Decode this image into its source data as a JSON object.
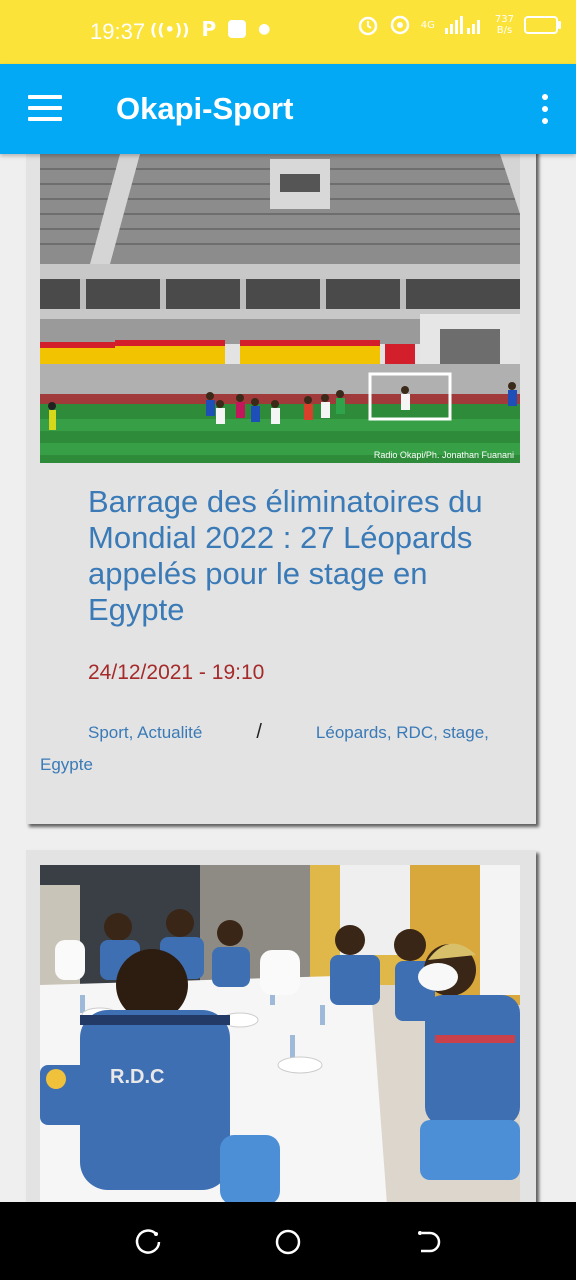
{
  "status_bar": {
    "time": "19:37",
    "network_speed": "737",
    "network_unit": "B/s",
    "network_type": "4G",
    "icons": [
      "wifi-calling-icon",
      "parking-icon",
      "app-icon",
      "dot-icon",
      "alarm-icon",
      "hotspot-icon",
      "signal-icon",
      "battery-icon"
    ]
  },
  "app_bar": {
    "title": "Okapi-Sport",
    "menu_icon": "hamburger-icon",
    "more_icon": "more-vert-icon"
  },
  "articles": [
    {
      "image_caption": "Radio Okapi/Ph. Jonathan Fuanani",
      "title": "Barrage des éliminatoires du Mondial 2022 : 27 Léopards appelés pour le stage en Egypte",
      "date": "24/12/2021 - 19:10",
      "categories": [
        "Sport",
        "Actualité"
      ],
      "separator": "/",
      "tags": [
        "Léopards",
        "RDC",
        "stage",
        "Egypte"
      ]
    },
    {
      "image_caption": "",
      "jersey_text": "R.D.C"
    }
  ],
  "colors": {
    "status_bar": "#fce33a",
    "app_bar": "#03a9f4",
    "link": "#3a7ab7",
    "date": "#a52a2a",
    "card": "#e3e3e3"
  },
  "nav_bar": {
    "buttons": [
      "recent-apps-icon",
      "home-icon",
      "back-icon"
    ]
  }
}
